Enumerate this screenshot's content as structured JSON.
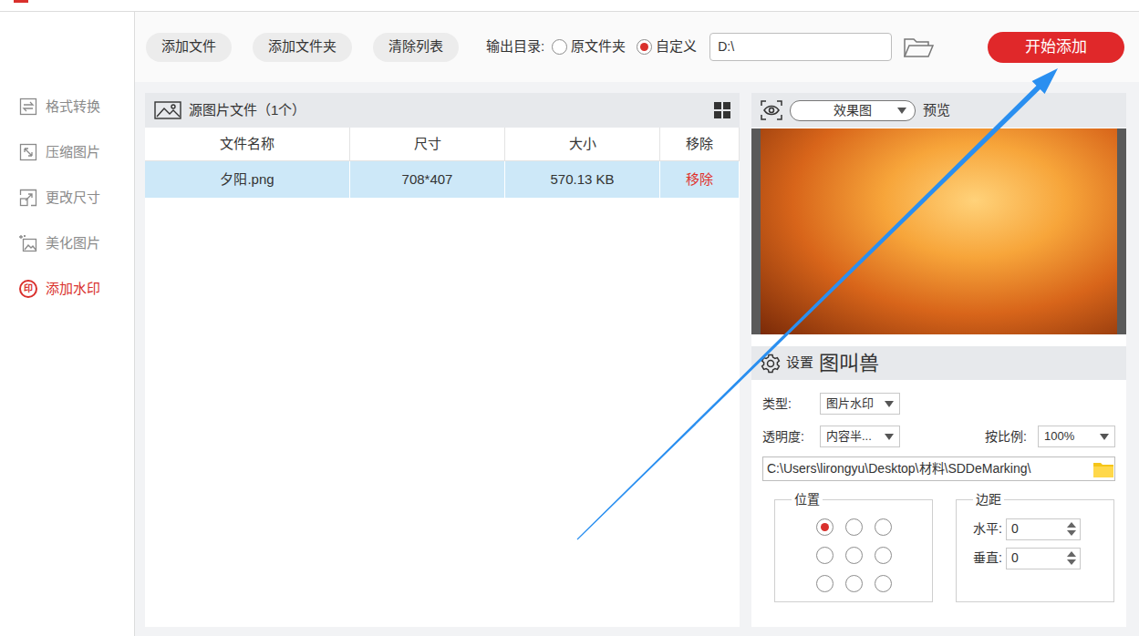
{
  "sidebar": {
    "items": [
      {
        "label": "格式转换",
        "selected": false
      },
      {
        "label": "压缩图片",
        "selected": false
      },
      {
        "label": "更改尺寸",
        "selected": false
      },
      {
        "label": "美化图片",
        "selected": false
      },
      {
        "label": "添加水印",
        "selected": true,
        "icon_text": "印"
      }
    ]
  },
  "toolbar": {
    "buttons": [
      "添加文件",
      "添加文件夹",
      "清除列表"
    ],
    "output_label": "输出目录:",
    "output_options": [
      {
        "label": "原文件夹",
        "selected": false
      },
      {
        "label": "自定义",
        "selected": true
      }
    ],
    "output_path": "D:\\",
    "start_button": "开始添加"
  },
  "file_panel": {
    "title": "源图片文件（1个）",
    "columns": [
      "文件名称",
      "尺寸",
      "大小",
      "移除"
    ],
    "rows": [
      {
        "cells": [
          "夕阳.png",
          "708*407",
          "570.13 KB"
        ],
        "remove": "移除",
        "selected": true
      }
    ]
  },
  "preview": {
    "mode": "效果图",
    "label": "预览"
  },
  "settings": {
    "title": "设置",
    "name": "图叫兽",
    "type_label": "类型:",
    "type": "图片水印",
    "opacity_label": "透明度:",
    "opacity": "内容半...",
    "scale_label": "按比例:",
    "scale": "100%",
    "path": "C:\\Users\\lirongyu\\Desktop\\材料\\SDDeMarking\\",
    "position_title": "位置",
    "positions": [
      {
        "selected": true
      },
      {
        "selected": false
      },
      {
        "selected": false
      },
      {
        "selected": false
      },
      {
        "selected": false
      },
      {
        "selected": false
      },
      {
        "selected": false
      },
      {
        "selected": false
      },
      {
        "selected": false
      }
    ],
    "margin_title": "边距",
    "margins": [
      {
        "label": "水平:",
        "value": "0"
      },
      {
        "label": "垂直:",
        "value": "0"
      }
    ]
  }
}
